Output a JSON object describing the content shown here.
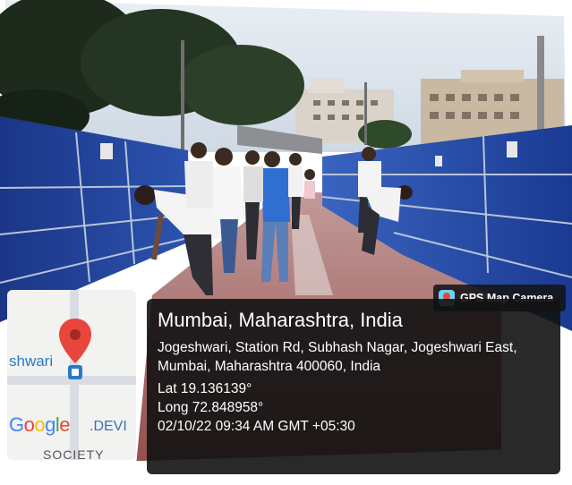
{
  "overlay": {
    "app_label": "GPS Map Camera",
    "app_icon": "gps-map-camera-icon",
    "location_title": "Mumbai, Maharashtra, India",
    "address": "Jogeshwari, Station Rd, Subhash Nagar, Jogeshwari East, Mumbai, Maharashtra 400060, India",
    "latitude": "Lat 19.136139°",
    "longitude": "Long 72.848958°",
    "timestamp": "02/10/22 09:34 AM GMT +05:30"
  },
  "map_thumbnail": {
    "place_label": "shwari",
    "brand": "Google",
    "area_label": ".DEVI",
    "area_label_2": "SOCIETY",
    "pin_icon": "map-pin-icon",
    "pin_color": "#e8453c"
  },
  "colors": {
    "panel_bg": "#121212",
    "fence_blue": "#1f3f8f",
    "walkway_red": "#a85f5c"
  }
}
